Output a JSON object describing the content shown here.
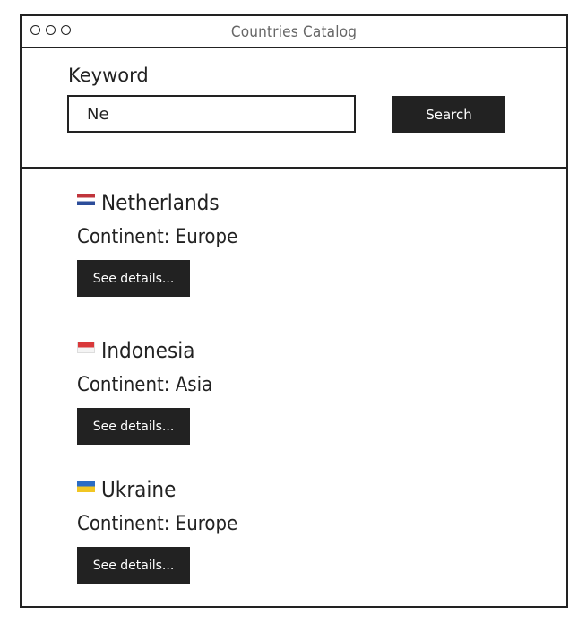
{
  "window": {
    "title": "Countries Catalog"
  },
  "search": {
    "label": "Keyword",
    "value": "Ne",
    "button_label": "Search"
  },
  "results": [
    {
      "name": "Netherlands",
      "continent": "Continent: Europe",
      "flag": "netherlands-flag",
      "button_label": "See details..."
    },
    {
      "name": "Indonesia",
      "continent": "Continent: Asia",
      "flag": "indonesia-flag",
      "button_label": "See details..."
    },
    {
      "name": "Ukraine",
      "continent": "Continent: Europe",
      "flag": "ukraine-flag",
      "button_label": "See details..."
    }
  ],
  "colors": {
    "ink": "#222222",
    "button_bg": "#222222",
    "button_text": "#ffffff",
    "title_text": "#666666"
  }
}
